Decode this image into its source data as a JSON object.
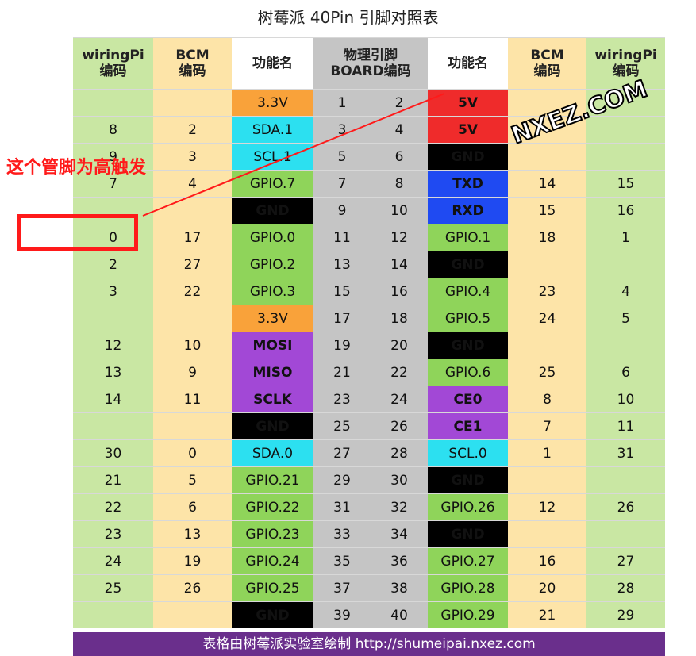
{
  "title": "树莓派 40Pin 引脚对照表",
  "headers": {
    "wpi": "wiringPi",
    "wpi_sub": "编码",
    "bcm": "BCM",
    "bcm_sub": "编码",
    "func": "功能名",
    "phys": "物理引脚",
    "phys_sub": "BOARD编码"
  },
  "rows": [
    {
      "lw": "",
      "lb": "",
      "lf": "3.3V",
      "lp": "1",
      "rp": "2",
      "rf": "5V",
      "rb": "",
      "rw": ""
    },
    {
      "lw": "8",
      "lb": "2",
      "lf": "SDA.1",
      "lp": "3",
      "rp": "4",
      "rf": "5V",
      "rb": "",
      "rw": ""
    },
    {
      "lw": "9",
      "lb": "3",
      "lf": "SCL.1",
      "lp": "5",
      "rp": "6",
      "rf": "GND",
      "rb": "",
      "rw": ""
    },
    {
      "lw": "7",
      "lb": "4",
      "lf": "GPIO.7",
      "lp": "7",
      "rp": "8",
      "rf": "TXD",
      "rb": "14",
      "rw": "15"
    },
    {
      "lw": "",
      "lb": "",
      "lf": "GND",
      "lp": "9",
      "rp": "10",
      "rf": "RXD",
      "rb": "15",
      "rw": "16"
    },
    {
      "lw": "0",
      "lb": "17",
      "lf": "GPIO.0",
      "lp": "11",
      "rp": "12",
      "rf": "GPIO.1",
      "rb": "18",
      "rw": "1"
    },
    {
      "lw": "2",
      "lb": "27",
      "lf": "GPIO.2",
      "lp": "13",
      "rp": "14",
      "rf": "GND",
      "rb": "",
      "rw": ""
    },
    {
      "lw": "3",
      "lb": "22",
      "lf": "GPIO.3",
      "lp": "15",
      "rp": "16",
      "rf": "GPIO.4",
      "rb": "23",
      "rw": "4"
    },
    {
      "lw": "",
      "lb": "",
      "lf": "3.3V",
      "lp": "17",
      "rp": "18",
      "rf": "GPIO.5",
      "rb": "24",
      "rw": "5"
    },
    {
      "lw": "12",
      "lb": "10",
      "lf": "MOSI",
      "lp": "19",
      "rp": "20",
      "rf": "GND",
      "rb": "",
      "rw": ""
    },
    {
      "lw": "13",
      "lb": "9",
      "lf": "MISO",
      "lp": "21",
      "rp": "22",
      "rf": "GPIO.6",
      "rb": "25",
      "rw": "6"
    },
    {
      "lw": "14",
      "lb": "11",
      "lf": "SCLK",
      "lp": "23",
      "rp": "24",
      "rf": "CE0",
      "rb": "8",
      "rw": "10"
    },
    {
      "lw": "",
      "lb": "",
      "lf": "GND",
      "lp": "25",
      "rp": "26",
      "rf": "CE1",
      "rb": "7",
      "rw": "11"
    },
    {
      "lw": "30",
      "lb": "0",
      "lf": "SDA.0",
      "lp": "27",
      "rp": "28",
      "rf": "SCL.0",
      "rb": "1",
      "rw": "31"
    },
    {
      "lw": "21",
      "lb": "5",
      "lf": "GPIO.21",
      "lp": "29",
      "rp": "30",
      "rf": "GND",
      "rb": "",
      "rw": ""
    },
    {
      "lw": "22",
      "lb": "6",
      "lf": "GPIO.22",
      "lp": "31",
      "rp": "32",
      "rf": "GPIO.26",
      "rb": "12",
      "rw": "26"
    },
    {
      "lw": "23",
      "lb": "13",
      "lf": "GPIO.23",
      "lp": "33",
      "rp": "34",
      "rf": "GND",
      "rb": "",
      "rw": ""
    },
    {
      "lw": "24",
      "lb": "19",
      "lf": "GPIO.24",
      "lp": "35",
      "rp": "36",
      "rf": "GPIO.27",
      "rb": "16",
      "rw": "27"
    },
    {
      "lw": "25",
      "lb": "26",
      "lf": "GPIO.25",
      "lp": "37",
      "rp": "38",
      "rf": "GPIO.28",
      "rb": "20",
      "rw": "28"
    },
    {
      "lw": "",
      "lb": "",
      "lf": "GND",
      "lp": "39",
      "rp": "40",
      "rf": "GPIO.29",
      "rb": "21",
      "rw": "29"
    }
  ],
  "footer": "表格由树莓派实验室绘制 http://shumeipai.nxez.com",
  "watermark": "NXEZ.COM",
  "annotation": "这个管脚为高触发",
  "colors": {
    "wiringpi_col": "#c9e7a3",
    "bcm_col": "#fde4a8",
    "physical_col": "#c5c5c5",
    "gpio": "#8fd45a",
    "power_3v3": "#f9a23a",
    "power_5v": "#ef2b2b",
    "ground": "#000000",
    "i2c": "#2ce0f0",
    "uart": "#1f4af2",
    "spi": "#a248d6",
    "footer": "#6a2f8c",
    "annotation": "#ff1a1a"
  }
}
